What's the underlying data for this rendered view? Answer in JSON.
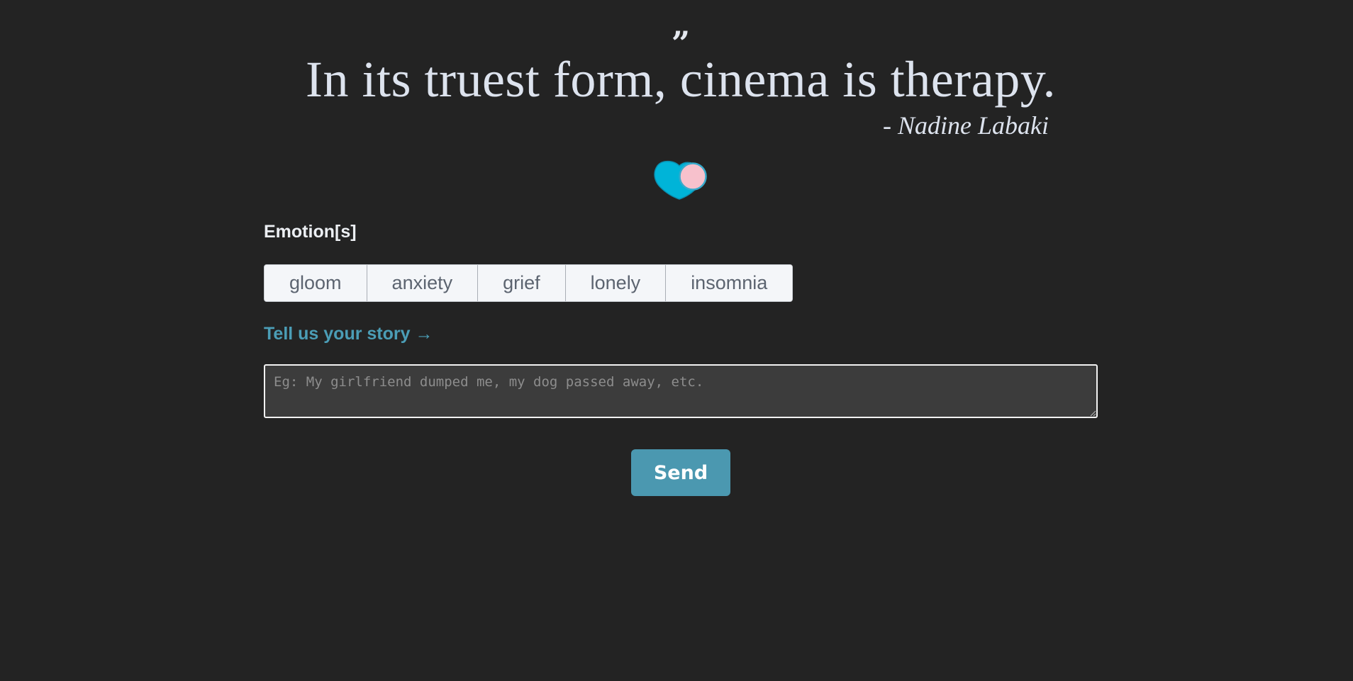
{
  "quote": {
    "mark": "”",
    "text": "In its truest form, cinema is therapy.",
    "author": "- Nadine Labaki"
  },
  "logo": {
    "icon": "heart-logo-icon",
    "colors": {
      "primary": "#00b4d8",
      "secondary": "#f7c1cc"
    }
  },
  "emotions": {
    "label": "Emotion[s]",
    "options": [
      "gloom",
      "anxiety",
      "grief",
      "lonely",
      "insomnia"
    ]
  },
  "story": {
    "link_label": "Tell us your story →",
    "placeholder": "Eg: My girlfriend dumped me, my dog passed away, etc.",
    "value": ""
  },
  "send": {
    "label": "Send"
  },
  "colors": {
    "background": "#232323",
    "accent": "#4b98b0",
    "quote_text": "#dde3ee"
  }
}
